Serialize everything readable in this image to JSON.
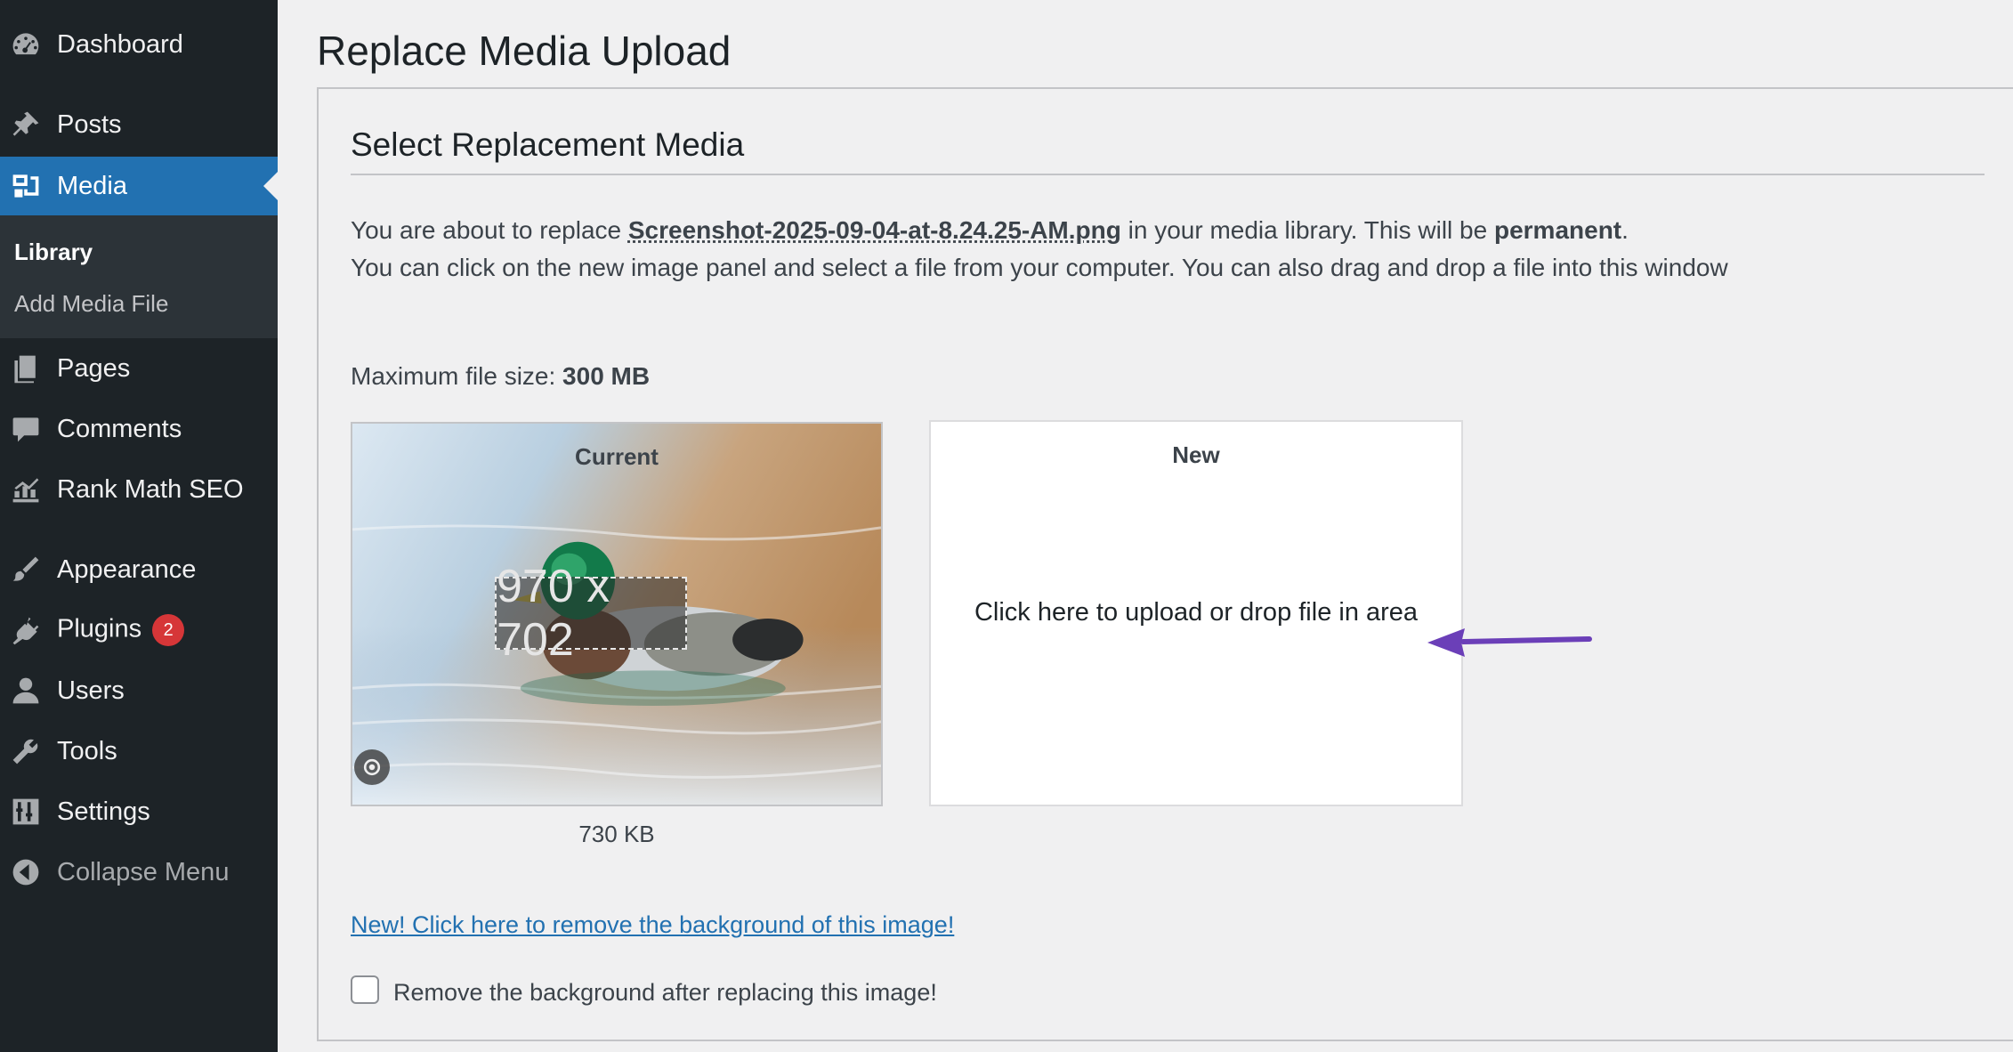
{
  "sidebar": {
    "items": [
      {
        "label": "Dashboard",
        "icon": "dashboard-icon"
      },
      {
        "label": "Posts",
        "icon": "pin-icon"
      },
      {
        "label": "Media",
        "icon": "media-icon",
        "current": true
      },
      {
        "label": "Pages",
        "icon": "pages-icon"
      },
      {
        "label": "Comments",
        "icon": "comment-icon"
      },
      {
        "label": "Rank Math SEO",
        "icon": "rankmath-icon"
      },
      {
        "label": "Appearance",
        "icon": "brush-icon"
      },
      {
        "label": "Plugins",
        "icon": "plug-icon",
        "badge": "2"
      },
      {
        "label": "Users",
        "icon": "user-icon"
      },
      {
        "label": "Tools",
        "icon": "wrench-icon"
      },
      {
        "label": "Settings",
        "icon": "settings-icon"
      },
      {
        "label": "Collapse Menu",
        "icon": "collapse-icon"
      }
    ],
    "submenu": [
      {
        "label": "Library",
        "current": true
      },
      {
        "label": "Add Media File"
      }
    ]
  },
  "page": {
    "title": "Replace Media Upload",
    "section_title": "Select Replacement Media",
    "intro_prefix": "You are about to replace ",
    "filename": "Screenshot-2025-09-04-at-8.24.25-AM.png",
    "intro_middle": " in your media library. This will be ",
    "intro_emphasis": "permanent",
    "intro_end": ".",
    "intro_line2": "You can click on the new image panel and select a file from your computer. You can also drag and drop a file into this window",
    "max_size_label": "Maximum file size: ",
    "max_size_value": "300 MB"
  },
  "current": {
    "label": "Current",
    "dimensions": "970 x 702",
    "size": "730 KB"
  },
  "new": {
    "label": "New",
    "hint": "Click here to upload or drop file in area"
  },
  "remove_bg": {
    "link": "New! Click here to remove the background of this image!",
    "checkbox_label": "Remove the background after replacing this image!",
    "checked": false
  },
  "colors": {
    "sidebar_bg": "#1d2327",
    "accent": "#2271b1",
    "badge": "#d63638",
    "arrow": "#6b3fb8"
  }
}
